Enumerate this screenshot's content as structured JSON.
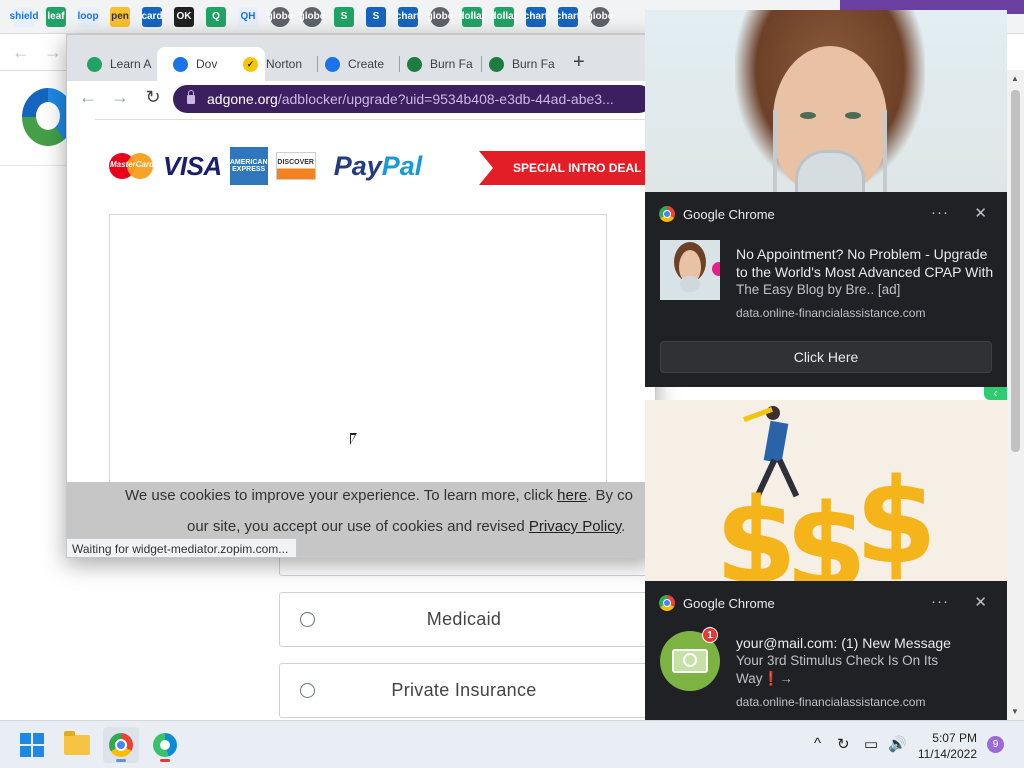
{
  "bookmarks": [
    "shield",
    "leaf",
    "loop",
    "pen",
    "card",
    "OK",
    "Q",
    "QH",
    "globe",
    "globe",
    "S",
    "S",
    "chart",
    "globe",
    "dollar",
    "dollar",
    "chart",
    "chart",
    "globe"
  ],
  "background_page": {
    "options": [
      {
        "label": "Medicaid"
      },
      {
        "label": "Private Insurance"
      }
    ]
  },
  "popup": {
    "tabs": [
      {
        "label": "Learn A"
      },
      {
        "label": "Dov",
        "active": true
      },
      {
        "label": "Norton"
      },
      {
        "label": "Create"
      },
      {
        "label": "Burn Fa"
      },
      {
        "label": "Burn Fa"
      }
    ],
    "close_glyph": "✕",
    "new_tab_glyph": "+",
    "nav": {
      "back": "←",
      "forward": "→",
      "reload": "↻"
    },
    "url_host": "adgone.org",
    "url_path": "/adblocker/upgrade?uid=9534b408-e3db-44ad-abe3...",
    "payments": {
      "mastercard": "MasterCard",
      "visa": "VISA",
      "amex": "AMERICAN EXPRESS",
      "discover": "DISCOVER",
      "paypal_a": "Pay",
      "paypal_b": "Pal"
    },
    "promo_label": "SPECIAL INTRO DEAL S",
    "cookie": {
      "line1_a": "We use cookies to improve your experience. To learn more, click ",
      "line1_link": "here",
      "line1_b": ". By co",
      "line2_a": "our site, you accept our use of cookies and revised ",
      "line2_link": "Privacy Policy",
      "line2_b": "."
    },
    "status_text": "Waiting for widget-mediator.zopim.com..."
  },
  "notifications": [
    {
      "app": "Google Chrome",
      "title": "No Appointment? No Problem - Upgrade to the World's Most Advanced CPAP With",
      "body": "The Easy Blog by Bre.. [ad]",
      "source": "data.online-financialassistance.com",
      "button": "Click Here",
      "menu": "···",
      "close": "✕"
    },
    {
      "app": "Google Chrome",
      "title": "your@mail.com: (1) New Message",
      "body": "Your 3rd Stimulus Check Is On Its Way❗→",
      "source": "data.online-financialassistance.com",
      "badge": "1",
      "menu": "···",
      "close": "✕"
    }
  ],
  "ad_images": {
    "dollar_glyphs": [
      "$",
      "$",
      "$"
    ]
  },
  "edge_arrow": "‹",
  "taskbar": {
    "tray_icons": [
      "^",
      "↻",
      "▭",
      "🔊"
    ],
    "time": "5:07 PM",
    "date": "11/14/2022",
    "notification_count": "9"
  },
  "colors": {
    "omnibox": "#3c1f5e",
    "promo": "#e41e26",
    "notification_bg": "#202124",
    "accent_green": "#2ecc71"
  }
}
